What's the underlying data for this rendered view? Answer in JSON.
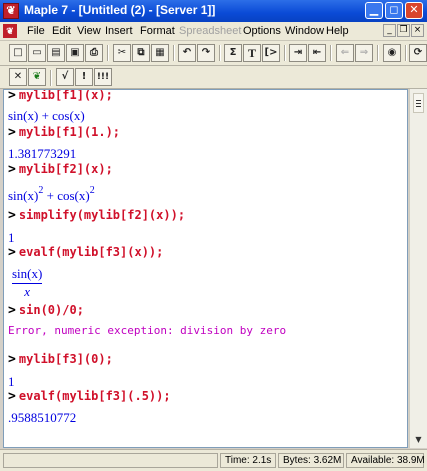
{
  "window": {
    "title": "Maple 7 - [Untitled (2) - [Server 1]]",
    "app_icon": "maple-leaf-icon"
  },
  "menubar": {
    "items": [
      "File",
      "Edit",
      "View",
      "Insert",
      "Format",
      "Spreadsheet",
      "Options",
      "Window",
      "Help"
    ],
    "disabled": [
      "Spreadsheet"
    ]
  },
  "toolbar1": {
    "buttons": [
      "new-icon",
      "open-icon",
      "save-file-icon",
      "save-icon",
      "print-icon",
      "cut-icon",
      "copy-icon",
      "paste-icon",
      "undo-icon",
      "redo-icon",
      "sigma-icon",
      "T-icon",
      "insert-prompt-icon",
      "indent-icon",
      "outdent-icon",
      "back-arrow-icon",
      "forward-arrow-icon",
      "stop-icon",
      "restart-icon"
    ],
    "labels": {
      "sigma": "Σ",
      "text": "T",
      "bracket": "[>"
    }
  },
  "toolbar2": {
    "buttons": [
      "text-mode-icon",
      "maple-mode-icon",
      "math-input-icon",
      "execute-icon",
      "execute-all-icon"
    ],
    "labels": {
      "exec": "!",
      "exec_all": "!!!"
    }
  },
  "worksheet": {
    "prompt": ">",
    "lines": [
      {
        "type": "input",
        "text": "mylib[f1](x);"
      },
      {
        "type": "output",
        "text": "sin(x) + cos(x)"
      },
      {
        "type": "input",
        "text": "mylib[f1](1.);"
      },
      {
        "type": "output",
        "text": "1.381773291"
      },
      {
        "type": "input",
        "text": "mylib[f2](x);"
      },
      {
        "type": "output",
        "base1": "sin(x)",
        "exp1": "2",
        "plus": " + ",
        "base2": "cos(x)",
        "exp2": "2"
      },
      {
        "type": "input",
        "text": "simplify(mylib[f2](x));"
      },
      {
        "type": "output",
        "text": "1"
      },
      {
        "type": "input",
        "text": "evalf(mylib[f3](x));"
      },
      {
        "type": "output",
        "numerator": "sin(x)",
        "denominator": "x"
      },
      {
        "type": "input",
        "text": "sin(0)/0;"
      },
      {
        "type": "error",
        "text": "Error, numeric exception: division by zero"
      },
      {
        "type": "input",
        "text": "mylib[f3](0);"
      },
      {
        "type": "output",
        "text": "1"
      },
      {
        "type": "input",
        "text": "evalf(mylib[f3](.5));"
      },
      {
        "type": "output",
        "text": ".9588510772"
      }
    ]
  },
  "statusbar": {
    "time": "Time:  2.1s",
    "bytes": "Bytes: 3.62M",
    "available": "Available: 38.9M"
  }
}
